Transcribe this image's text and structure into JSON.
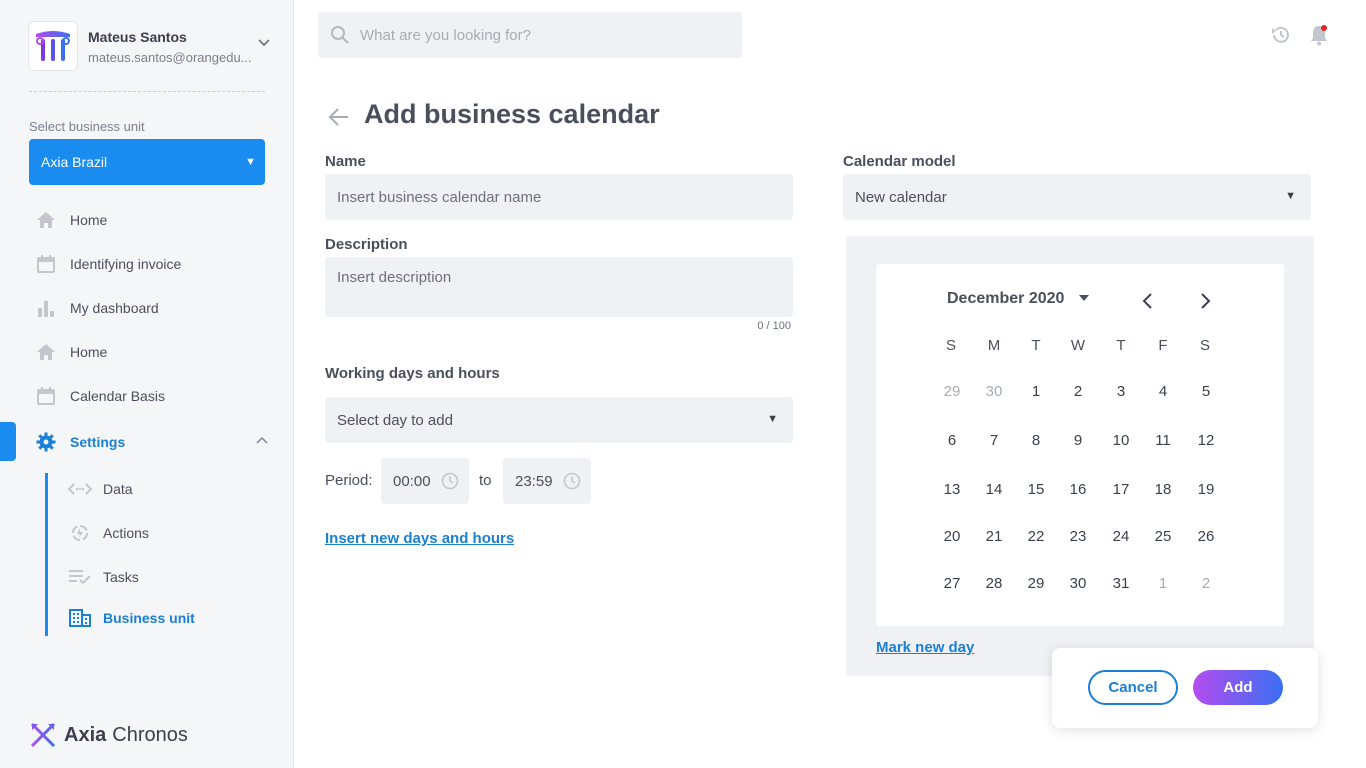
{
  "profile": {
    "name": "Mateus Santos",
    "email": "mateus.santos@orangedu..."
  },
  "business_unit": {
    "label": "Select business unit",
    "selected": "Axia Brazil"
  },
  "nav": {
    "items": [
      {
        "label": "Home",
        "icon": "home-icon"
      },
      {
        "label": "Identifying invoice",
        "icon": "calendar-icon"
      },
      {
        "label": "My dashboard",
        "icon": "bar-chart-icon"
      },
      {
        "label": "Home",
        "icon": "home-icon"
      },
      {
        "label": "Calendar Basis",
        "icon": "calendar-icon"
      },
      {
        "label": "Settings",
        "icon": "gear-icon",
        "active": true
      }
    ],
    "settings_sub": [
      {
        "label": "Data",
        "icon": "code-icon"
      },
      {
        "label": "Actions",
        "icon": "actions-icon"
      },
      {
        "label": "Tasks",
        "icon": "tasks-icon"
      },
      {
        "label": "Business unit",
        "icon": "building-icon",
        "active": true
      }
    ]
  },
  "brand": {
    "bold": "Axia",
    "light": "Chronos"
  },
  "search": {
    "placeholder": "What are you looking for?"
  },
  "page": {
    "title": "Add business calendar"
  },
  "form": {
    "name_label": "Name",
    "name_placeholder": "Insert business calendar name",
    "description_label": "Description",
    "description_placeholder": "Insert description",
    "description_counter": "0  /  100",
    "working_label": "Working days and hours",
    "day_select": "Select day to add",
    "period_label": "Period:",
    "period_start": "00:00",
    "period_to": "to",
    "period_end": "23:59",
    "insert_link": "Insert new days and hours",
    "calendar_model_label": "Calendar model",
    "calendar_model_value": "New calendar"
  },
  "calendar": {
    "month": "December 2020",
    "weekdays": [
      "S",
      "M",
      "T",
      "W",
      "T",
      "F",
      "S"
    ],
    "weeks": [
      [
        {
          "d": "29",
          "m": true
        },
        {
          "d": "30",
          "m": true
        },
        {
          "d": "1"
        },
        {
          "d": "2"
        },
        {
          "d": "3"
        },
        {
          "d": "4"
        },
        {
          "d": "5"
        }
      ],
      [
        {
          "d": "6"
        },
        {
          "d": "7"
        },
        {
          "d": "8"
        },
        {
          "d": "9"
        },
        {
          "d": "10"
        },
        {
          "d": "11"
        },
        {
          "d": "12"
        }
      ],
      [
        {
          "d": "13"
        },
        {
          "d": "14"
        },
        {
          "d": "15"
        },
        {
          "d": "16"
        },
        {
          "d": "17"
        },
        {
          "d": "18"
        },
        {
          "d": "19"
        }
      ],
      [
        {
          "d": "20"
        },
        {
          "d": "21"
        },
        {
          "d": "22"
        },
        {
          "d": "23"
        },
        {
          "d": "24"
        },
        {
          "d": "25"
        },
        {
          "d": "26"
        }
      ],
      [
        {
          "d": "27"
        },
        {
          "d": "28"
        },
        {
          "d": "29"
        },
        {
          "d": "30"
        },
        {
          "d": "31"
        },
        {
          "d": "1",
          "m": true
        },
        {
          "d": "2",
          "m": true
        }
      ]
    ],
    "mark_link": "Mark new day"
  },
  "actions": {
    "cancel": "Cancel",
    "add": "Add"
  },
  "colors": {
    "accent": "#1a8cf0",
    "link": "#1a7fd6",
    "notification": "#e02424"
  }
}
